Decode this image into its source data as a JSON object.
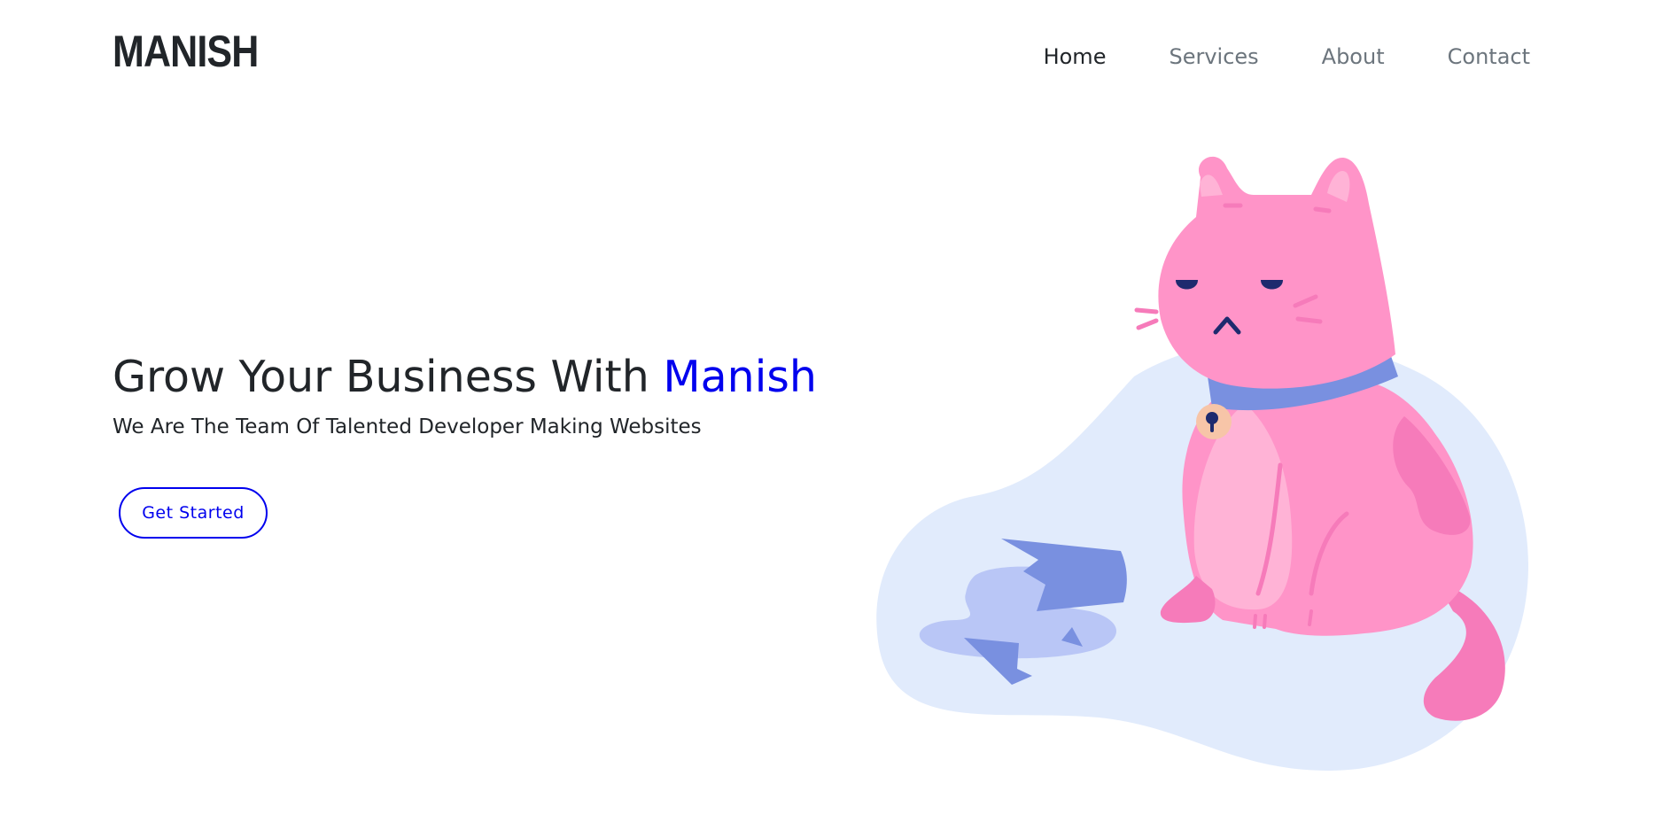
{
  "navbar": {
    "brand": "MANISH",
    "links": [
      {
        "label": "Home",
        "active": true
      },
      {
        "label": "Services",
        "active": false
      },
      {
        "label": "About",
        "active": false
      },
      {
        "label": "Contact",
        "active": false
      }
    ]
  },
  "hero": {
    "headline_prefix": "Grow Your Business With ",
    "headline_accent": "Manish",
    "subheadline": "We Are The Team Of Talented Developer Making Websites",
    "cta_label": "Get Started",
    "illustration_icon": "sad-cat-broken-pot-illustration"
  },
  "colors": {
    "accent": "#0000ee",
    "text": "#212529",
    "muted_nav": "#6c757d",
    "cat_pink": "#ff94c8",
    "blob_blue": "#e1ebfc",
    "collar": "#7990e0"
  }
}
